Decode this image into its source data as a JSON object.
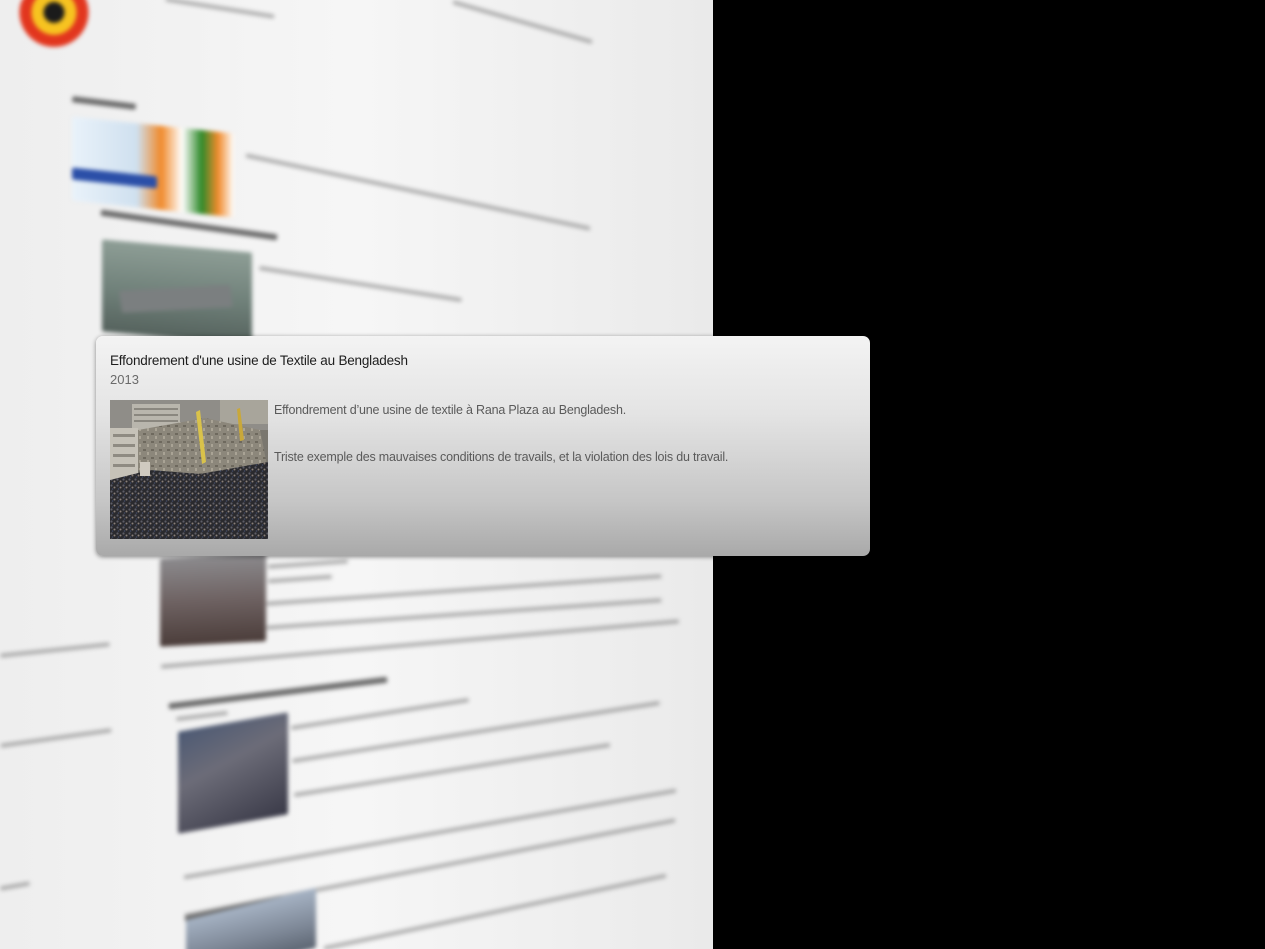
{
  "card": {
    "title": "Effondrement d'une usine de Textile au Bengladesh",
    "year": "2013",
    "description_line_1": "Effondrement d’une usine de textile à Rana Plaza au Bengladesh.",
    "description_line_2": "Triste exemple des mauvaises conditions de travails, et la violation des lois du travail.",
    "photo_icon": "collapsed-building-crowd-photo"
  },
  "background": {
    "logo_icon": "yin-yang-sun-logo",
    "thumbnail_icons": [
      "india-flags-thumbnail",
      "aircraft-carrier-thumbnail",
      "street-crowd-thumbnail",
      "protest-crowd-thumbnail",
      "city-aerial-thumbnail"
    ]
  },
  "colors": {
    "backdrop": "#000000",
    "page": "#f2f2f2",
    "card_top": "#f3f3f3",
    "card_bottom": "#a9a9a9"
  }
}
